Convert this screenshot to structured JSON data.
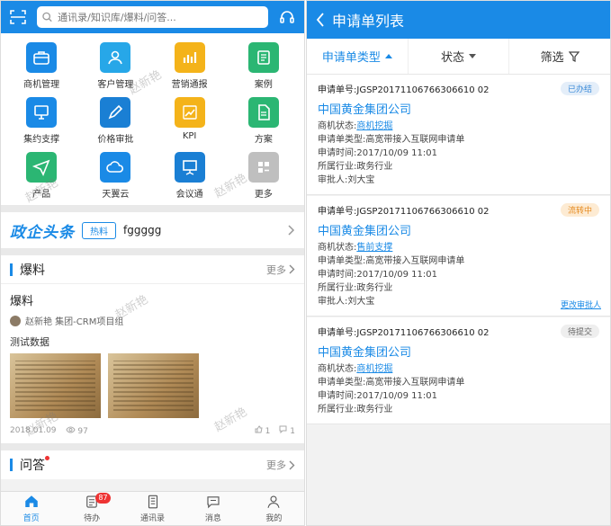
{
  "home": {
    "search_placeholder": "通讯录/知识库/爆料/问答...",
    "grid": [
      {
        "label": "商机管理",
        "icon": "briefcase-icon",
        "color": "#1a8ae6"
      },
      {
        "label": "客户管理",
        "icon": "customer-icon",
        "color": "#27a7e8"
      },
      {
        "label": "营销通报",
        "icon": "bar-chart-icon",
        "color": "#f4b31a"
      },
      {
        "label": "案例",
        "icon": "case-icon",
        "color": "#2bb673"
      },
      {
        "label": "集约支撑",
        "icon": "support-icon",
        "color": "#1a8ae6"
      },
      {
        "label": "价格审批",
        "icon": "pen-icon",
        "color": "#1a7fd4"
      },
      {
        "label": "KPI",
        "icon": "kpi-icon",
        "color": "#f4b31a"
      },
      {
        "label": "方案",
        "icon": "document-icon",
        "color": "#2bb673"
      },
      {
        "label": "产品",
        "icon": "send-icon",
        "color": "#2bb673"
      },
      {
        "label": "天翼云",
        "icon": "cloud-icon",
        "color": "#1a8ae6"
      },
      {
        "label": "会议通",
        "icon": "presentation-icon",
        "color": "#1a7fd4"
      },
      {
        "label": "更多",
        "icon": "more-icon",
        "color": "#bfbfbf"
      }
    ],
    "headline": {
      "logo": "政企头条",
      "badge": "热料",
      "text": "fggggg"
    },
    "baoliao": {
      "title": "爆料",
      "more": "更多",
      "post_title": "爆料",
      "author": "赵新艳 集团-CRM项目组",
      "desc": "测试数据",
      "date": "2018.01.09",
      "views": "97",
      "likes": "1",
      "comments": "1"
    },
    "wenda": {
      "title": "问答",
      "more": "更多"
    },
    "tabs": [
      {
        "label": "首页",
        "icon": "home-icon"
      },
      {
        "label": "待办",
        "icon": "todo-icon",
        "badge": "87"
      },
      {
        "label": "通讯录",
        "icon": "contacts-icon"
      },
      {
        "label": "消息",
        "icon": "message-icon"
      },
      {
        "label": "我的",
        "icon": "user-icon"
      }
    ],
    "watermark": "赵新艳"
  },
  "list": {
    "title": "申请单列表",
    "filters": {
      "type": "申请单类型",
      "status": "状态",
      "filter": "筛选"
    },
    "cards": [
      {
        "no": "申请单号:JGSP20171106766306610 02",
        "status": "已办结",
        "company": "中国黄金集团公司",
        "opp_label": "商机状态:",
        "opp_value": "商机挖掘",
        "type": "申请单类型:高宽带接入互联网申请单",
        "time": "申请时间:2017/10/09 11:01",
        "industry": "所属行业:政务行业",
        "approver": "审批人:刘大宝"
      },
      {
        "no": "申请单号:JGSP20171106766306610 02",
        "status": "流转中",
        "company": "中国黄金集团公司",
        "opp_label": "商机状态:",
        "opp_value": "售前支撑",
        "type": "申请单类型:高宽带接入互联网申请单",
        "time": "申请时间:2017/10/09 11:01",
        "industry": "所属行业:政务行业",
        "approver": "审批人:刘大宝",
        "change": "更改审批人"
      },
      {
        "no": "申请单号:JGSP20171106766306610 02",
        "status": "待提交",
        "company": "中国黄金集团公司",
        "opp_label": "商机状态:",
        "opp_value": "商机挖掘",
        "type": "申请单类型:高宽带接入互联网申请单",
        "time": "申请时间:2017/10/09 11:01",
        "industry": "所属行业:政务行业"
      }
    ]
  }
}
